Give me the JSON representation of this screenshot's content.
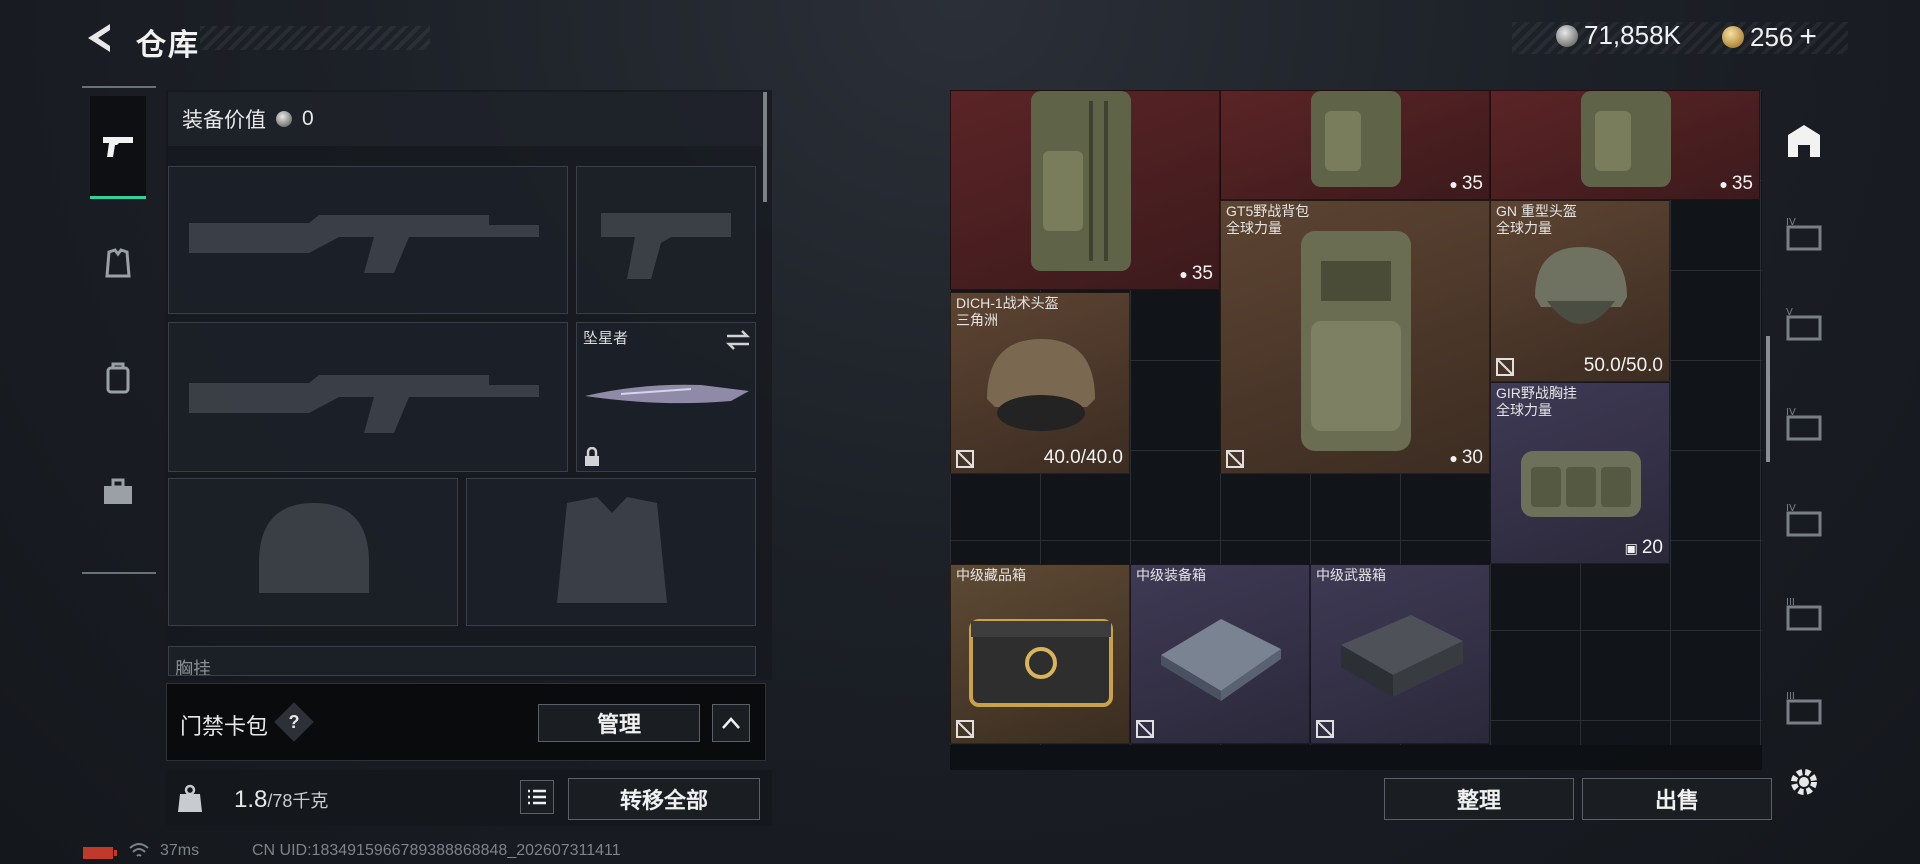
{
  "header": {
    "title": "仓库"
  },
  "currency": {
    "silver": "71,858K",
    "gold": "256",
    "plus": "+"
  },
  "loadout": {
    "equip_value_label": "装备价值",
    "equip_value": "0",
    "melee_name": "坠星者",
    "chest_rig_label": "胸挂",
    "keycard_label": "门禁卡包",
    "help": "?",
    "manage_button": "管理",
    "weight_value": "1.8",
    "weight_max": "/78千克",
    "transfer_all_button": "转移全部"
  },
  "status_bar": {
    "ping": "37ms",
    "uid": "CN UID:1834915966789388868848_202607311411"
  },
  "inventory": {
    "items": [
      {
        "name": "",
        "sub": "",
        "value": "35",
        "kind": "backpack"
      },
      {
        "name": "",
        "sub": "",
        "value": "35",
        "kind": "backpack"
      },
      {
        "name": "",
        "sub": "",
        "value": "35",
        "kind": "backpack"
      },
      {
        "name": "GT5野战背包",
        "sub": "全球力量",
        "value": "30",
        "kind": "backpack"
      },
      {
        "name": "GN 重型头盔",
        "sub": "全球力量",
        "value": "50.0/50.0",
        "kind": "helmet"
      },
      {
        "name": "DICH-1战术头盔",
        "sub": "三角洲",
        "value": "40.0/40.0",
        "kind": "helmet"
      },
      {
        "name": "GIR野战胸挂",
        "sub": "全球力量",
        "value": "20",
        "kind": "rig"
      },
      {
        "name": "中级藏品箱",
        "sub": "",
        "value": "",
        "kind": "case"
      },
      {
        "name": "中级装备箱",
        "sub": "",
        "value": "",
        "kind": "case"
      },
      {
        "name": "中级武器箱",
        "sub": "",
        "value": "",
        "kind": "case"
      }
    ],
    "sort_button": "整理",
    "sell_button": "出售"
  },
  "colors": {
    "accent": "#2fd39a",
    "red_tier": "#5b2426",
    "gold_tier": "#5d4432",
    "purple_tier": "#3f3a55"
  },
  "icons": [
    "back-arrow-icon",
    "silver-coin-icon",
    "gold-coin-icon",
    "pistol-icon",
    "armor-icon",
    "backpack-icon",
    "toolbox-icon",
    "lock-icon",
    "swap-icon",
    "list-icon",
    "chevron-up-icon",
    "no-trade-icon",
    "settings-icon",
    "storage-tab-icon"
  ]
}
